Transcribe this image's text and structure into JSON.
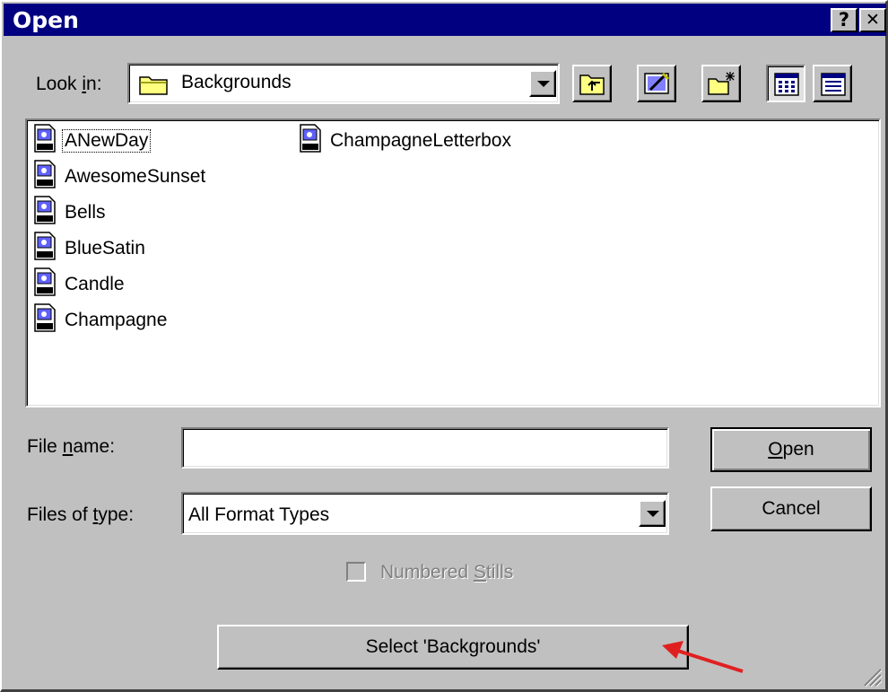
{
  "window": {
    "title": "Open",
    "help_label": "?",
    "close_label": "✕"
  },
  "look_in": {
    "label": "Look in:",
    "value": "Backgrounds"
  },
  "toolbar": {
    "icons": [
      "up-one-level-icon",
      "desktop-icon",
      "new-folder-icon",
      "list-view-icon",
      "details-view-icon"
    ]
  },
  "files": [
    {
      "name": "ANewDay"
    },
    {
      "name": "AwesomeSunset"
    },
    {
      "name": "Bells"
    },
    {
      "name": "BlueSatin"
    },
    {
      "name": "Candle"
    },
    {
      "name": "Champagne"
    },
    {
      "name": "ChampagneLetterbox"
    }
  ],
  "file_name": {
    "label": "File name:",
    "value": ""
  },
  "files_of_type": {
    "label": "Files of type:",
    "value": "All Format Types"
  },
  "numbered_stills": {
    "label": "Numbered Stills",
    "checked": false,
    "enabled": false
  },
  "buttons": {
    "open": "Open",
    "cancel": "Cancel",
    "select_folder": "Select 'Backgrounds'"
  },
  "colors": {
    "titlebar": "#000080",
    "face": "#c0c0c0",
    "annotation_arrow": "#e02020"
  }
}
